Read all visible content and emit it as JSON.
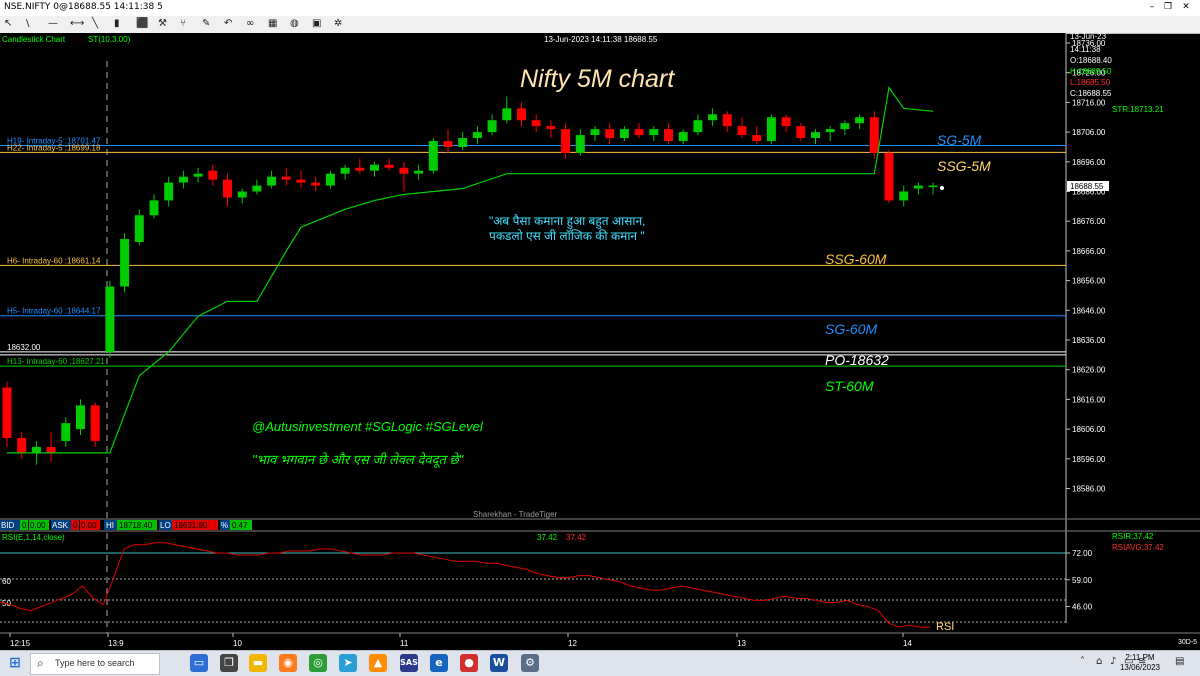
{
  "window": {
    "title": "NSE.NIFTY 0@18688.55 14:11:38 5"
  },
  "toolbar": {
    "icons": [
      "cursor-icon",
      "line-icon",
      "horizontal-line-icon",
      "arrow-icon",
      "trendline-icon",
      "volume-bars-icon",
      "box-icon",
      "tools-icon",
      "fork-icon",
      "pen-icon",
      "undo-icon",
      "link-icon",
      "grid-icon",
      "globe-icon",
      "calculator-icon",
      "gear-icon"
    ],
    "symbols": [
      "↖",
      "\\",
      "—",
      "⟷",
      "╲",
      "▮",
      "⬛",
      "⚒",
      "⑂",
      "✎",
      "↶",
      "∞",
      "▦",
      "◍",
      "▣",
      "✲"
    ]
  },
  "chart": {
    "label": "Candlestick Chart",
    "indicator": "ST(10,3.00)",
    "datetime_header": "13-Jun-2023 14:11:38 18688.55",
    "title": "Nifty 5M chart",
    "watermark": "Sharekhan - TradeTiger",
    "hindi_quote_line1": "\"अब पैसा कमाना हुआ बहुत आसान,",
    "hindi_quote_line2": "पकडलो एस जी लॉजिक की कमान \"",
    "hashtags": "@Autusinvestment  #SGLogic  #SGLevel",
    "gujarati_quote": "\"भाव भगवान छे और एस जी लेवल देवदूत छे\"",
    "last_price_box": "18688.55",
    "str_label": "STR:18713.21",
    "info_panel": {
      "date": "13-Jun-23",
      "time": "14:11:38",
      "open": "O:18688.40",
      "high": "H:18689.50",
      "low": "L:18685.50",
      "close": "C:18688.55"
    },
    "level_labels": {
      "sg5m": "SG-5M",
      "ssg5m": "SSG-5M",
      "ssg60m": "SSG-60M",
      "sg60m": "SG-60M",
      "po": "PO-18632",
      "st60m": "ST-60M"
    },
    "line_labels": {
      "h19": "H19- Intraday-5 :18701.47",
      "h22": "H22- Intraday-5 :18699.18",
      "h6": "H6- Intraday-60 :18661.14",
      "h5": "H5- Intraday-60 :18644.17",
      "po_left": "18632.00",
      "h13": "H13- Intraday-60 :18627.21"
    },
    "y_ticks": [
      "18736.00",
      "18726.00",
      "18716.00",
      "18706.00",
      "18696.00",
      "18686.00",
      "18676.00",
      "18666.00",
      "18656.00",
      "18646.00",
      "18636.00",
      "18626.00",
      "18616.00",
      "18606.00",
      "18596.00",
      "18586.00"
    ]
  },
  "quote_bar": {
    "bid_label": "BID",
    "bid_qty": "0",
    "bid": "0.00",
    "ask_label": "ASK",
    "ask_qty": "0",
    "ask": "0.00",
    "hi_label": "HI",
    "hi": "18718.40",
    "lo_label": "LO",
    "lo": "18631.80",
    "pct_label": "%",
    "pct": "0.47"
  },
  "rsi": {
    "label": "RSI(E,1,14,close)",
    "value_a": "37.42",
    "value_b": "37.42",
    "rsir": "RSIR:37.42",
    "rsiavg": "RSIAVG:37.42",
    "tag": "RSI",
    "left_60": "60",
    "left_50": "50",
    "y_ticks": [
      "72.00",
      "59.00",
      "46.00"
    ]
  },
  "x_axis": [
    "12:15",
    "13:9",
    "10",
    "11",
    "12",
    "13",
    "14"
  ],
  "x_corner": "30D-5",
  "chart_data": {
    "type": "candlestick",
    "candles": [
      [
        18620,
        18622,
        18600,
        18603
      ],
      [
        18603,
        18605,
        18596,
        18598
      ],
      [
        18598,
        18602,
        18594,
        18600
      ],
      [
        18600,
        18605,
        18595,
        18598
      ],
      [
        18602,
        18610,
        18600,
        18608
      ],
      [
        18606,
        18616,
        18604,
        18614
      ],
      [
        18614,
        18615,
        18600,
        18602
      ],
      [
        18632,
        18656,
        18630,
        18654
      ],
      [
        18654,
        18672,
        18652,
        18670
      ],
      [
        18669,
        18680,
        18668,
        18678
      ],
      [
        18678,
        18685,
        18677,
        18683
      ],
      [
        18683,
        18691,
        18681,
        18689
      ],
      [
        18689,
        18693,
        18687,
        18691
      ],
      [
        18691,
        18694,
        18689,
        18692
      ],
      [
        18693,
        18695,
        18688,
        18690
      ],
      [
        18690,
        18692,
        18681,
        18684
      ],
      [
        18684,
        18687,
        18682,
        18686
      ],
      [
        18686,
        18690,
        18685,
        18688
      ],
      [
        18688,
        18693,
        18687,
        18691
      ],
      [
        18691,
        18694,
        18688,
        18690
      ],
      [
        18690,
        18693,
        18687,
        18689
      ],
      [
        18689,
        18691,
        18686,
        18688
      ],
      [
        18688,
        18693,
        18687,
        18692
      ],
      [
        18692,
        18695,
        18690,
        18694
      ],
      [
        18694,
        18697,
        18692,
        18693
      ],
      [
        18693,
        18696,
        18691,
        18695
      ],
      [
        18695,
        18697,
        18693,
        18694
      ],
      [
        18694,
        18696,
        18686,
        18692
      ],
      [
        18692,
        18695,
        18690,
        18693
      ],
      [
        18693,
        18704,
        18692,
        18703
      ],
      [
        18703,
        18707,
        18699,
        18701
      ],
      [
        18701,
        18706,
        18700,
        18704
      ],
      [
        18704,
        18708,
        18702,
        18706
      ],
      [
        18706,
        18712,
        18705,
        18710
      ],
      [
        18710,
        18718,
        18709,
        18714
      ],
      [
        18714,
        18716,
        18708,
        18710
      ],
      [
        18710,
        18712,
        18706,
        18708
      ],
      [
        18708,
        18710,
        18704,
        18707
      ],
      [
        18707,
        18709,
        18697,
        18699
      ],
      [
        18699,
        18707,
        18698,
        18705
      ],
      [
        18705,
        18708,
        18703,
        18707
      ],
      [
        18707,
        18709,
        18702,
        18704
      ],
      [
        18704,
        18708,
        18703,
        18707
      ],
      [
        18707,
        18709,
        18704,
        18705
      ],
      [
        18705,
        18708,
        18703,
        18707
      ],
      [
        18707,
        18709,
        18702,
        18703
      ],
      [
        18703,
        18707,
        18702,
        18706
      ],
      [
        18706,
        18712,
        18705,
        18710
      ],
      [
        18710,
        18714,
        18708,
        18712
      ],
      [
        18712,
        18713,
        18706,
        18708
      ],
      [
        18708,
        18711,
        18704,
        18705
      ],
      [
        18705,
        18708,
        18702,
        18703
      ],
      [
        18703,
        18712,
        18702,
        18711
      ],
      [
        18711,
        18712,
        18706,
        18708
      ],
      [
        18708,
        18709,
        18703,
        18704
      ],
      [
        18704,
        18707,
        18702,
        18706
      ],
      [
        18706,
        18708,
        18703,
        18707
      ],
      [
        18707,
        18710,
        18705,
        18709
      ],
      [
        18709,
        18712,
        18707,
        18711
      ],
      [
        18711,
        18713,
        18697,
        18699
      ],
      [
        18699,
        18700,
        18682,
        18683
      ],
      [
        18683,
        18688,
        18681,
        18686
      ],
      [
        18687,
        18689,
        18685,
        18688
      ],
      [
        18688,
        18689,
        18685,
        18688
      ]
    ],
    "supertrend": [
      [
        0,
        18598
      ],
      [
        7,
        18598
      ],
      [
        9,
        18624
      ],
      [
        11,
        18632
      ],
      [
        13,
        18644
      ],
      [
        15,
        18649
      ],
      [
        17,
        18649
      ],
      [
        19,
        18666
      ],
      [
        20,
        18674
      ],
      [
        21,
        18676
      ],
      [
        23,
        18680
      ],
      [
        25,
        18683
      ],
      [
        27,
        18685
      ],
      [
        29,
        18686
      ],
      [
        31,
        18687
      ],
      [
        34,
        18692
      ],
      [
        59,
        18692
      ],
      [
        60,
        18721
      ],
      [
        61,
        18714
      ],
      [
        63,
        18713
      ]
    ],
    "rsi_values": [
      48,
      47,
      45,
      44,
      46,
      48,
      50,
      52,
      56,
      50,
      47,
      60,
      74,
      76,
      76,
      77,
      77,
      76,
      75,
      74,
      73,
      72,
      72,
      71,
      71,
      71,
      72,
      72,
      73,
      73,
      73,
      74,
      74,
      73,
      72,
      71,
      71,
      71,
      72,
      72,
      72,
      71,
      70,
      69,
      68,
      68,
      68,
      67,
      67,
      66,
      65,
      64,
      62,
      61,
      60,
      60,
      61,
      61,
      60,
      59,
      58,
      56,
      55,
      54,
      54,
      55,
      56,
      55,
      54,
      53,
      52,
      51,
      50,
      49,
      49,
      50,
      51,
      50,
      50,
      49,
      48,
      48,
      49,
      47,
      46,
      44,
      38,
      36,
      37,
      36,
      36
    ]
  }
}
